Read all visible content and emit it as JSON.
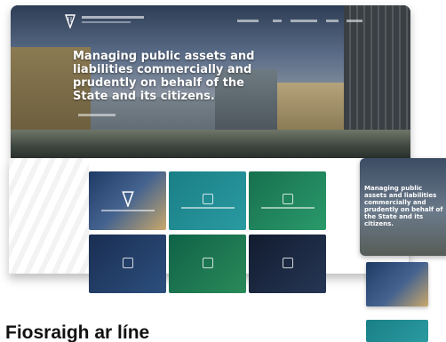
{
  "hero": {
    "headline": "Managing public assets and liabilities commercially and prudently on behalf of the State and its citizens."
  },
  "mobile": {
    "headline": "Managing public assets and liabilities commercially and prudently on behalf of the State and its citizens."
  },
  "section": {
    "heading": "Fiosraigh ar líne"
  },
  "colors": {
    "accent_teal": "#1a7f86",
    "accent_green": "#17704f",
    "navy": "#1a2e52"
  },
  "icons": [
    "harp-logo-icon",
    "handshake-icon",
    "chart-icon",
    "document-icon",
    "leaf-icon",
    "scales-icon"
  ]
}
